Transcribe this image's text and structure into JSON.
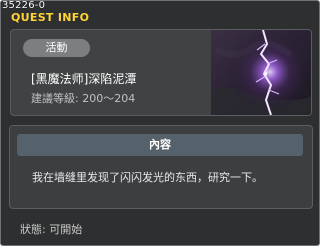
{
  "window": {
    "id": "35226-0",
    "title": "QUEST INFO"
  },
  "quest": {
    "category": "活動",
    "name": "[黑魔法师]深陷泥潭",
    "level": "建議等級: 200～204",
    "thumbnail_icon": "lightning-icon"
  },
  "content": {
    "header": "內容",
    "body": "我在墙缝里发现了闪闪发光的东西，研究一下。"
  },
  "status": {
    "text": "狀態: 可開始"
  },
  "colors": {
    "title": "#ffd533",
    "window_bg": "#2e2f30",
    "panel_bg": "#414243",
    "header_bg": "#55616b",
    "pill_bg": "#7c7e80"
  }
}
